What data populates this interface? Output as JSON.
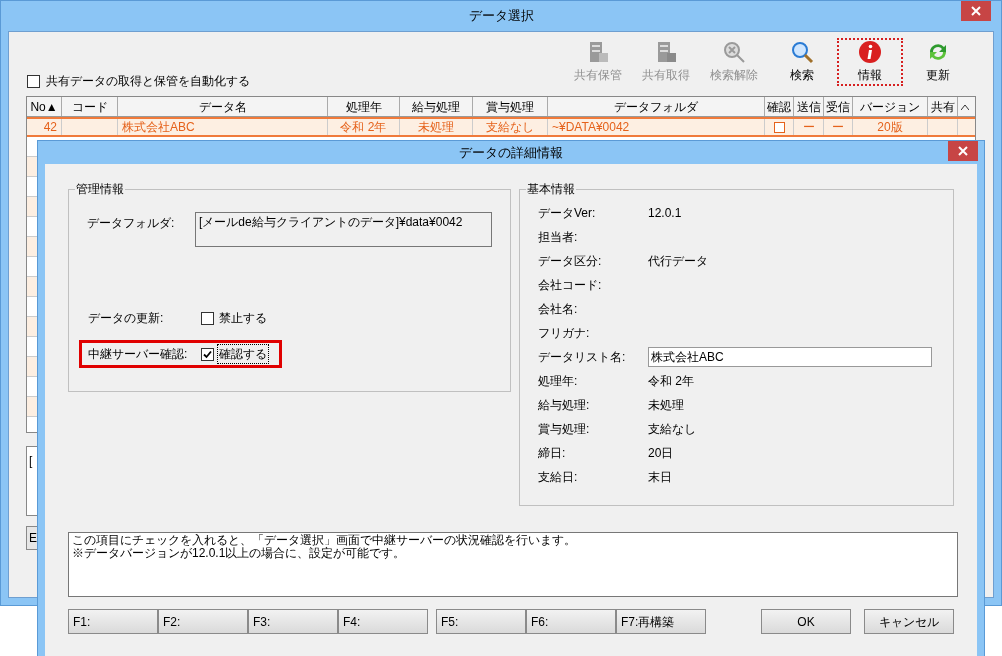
{
  "main_window": {
    "title": "データ選択",
    "toolbar": [
      {
        "kind": "store",
        "label": "共有保管",
        "disabled": true,
        "selected": false
      },
      {
        "kind": "fetch",
        "label": "共有取得",
        "disabled": true,
        "selected": false
      },
      {
        "kind": "clear-search",
        "label": "検索解除",
        "disabled": true,
        "selected": false
      },
      {
        "kind": "search",
        "label": "検索",
        "disabled": false,
        "selected": false
      },
      {
        "kind": "info",
        "label": "情報",
        "disabled": false,
        "selected": true
      },
      {
        "kind": "refresh",
        "label": "更新",
        "disabled": false,
        "selected": false
      }
    ],
    "auto_share": {
      "label": "共有データの取得と保管を自動化する",
      "checked": false
    },
    "table": {
      "columns": [
        "No▲",
        "コード",
        "データ名",
        "処理年",
        "給与処理",
        "賞与処理",
        "データフォルダ",
        "確認",
        "送信",
        "受信",
        "バージョン",
        "共有"
      ],
      "rows": [
        {
          "selected": true,
          "cells": [
            {
              "kind": "text",
              "text": "42"
            },
            {
              "kind": "empty"
            },
            {
              "kind": "text",
              "text": "株式会社ABC"
            },
            {
              "kind": "text",
              "text": "令和 2年"
            },
            {
              "kind": "text",
              "text": "未処理"
            },
            {
              "kind": "text",
              "text": "支給なし"
            },
            {
              "kind": "text",
              "text": "~¥DATA¥0042"
            },
            {
              "kind": "check",
              "checked": false
            },
            {
              "kind": "text",
              "text": "ー"
            },
            {
              "kind": "text",
              "text": "ー"
            },
            {
              "kind": "text",
              "text": "20版"
            },
            {
              "kind": "empty"
            }
          ]
        }
      ]
    },
    "note_fragment": "[",
    "bottom_button": "E"
  },
  "dialog": {
    "title": "データの詳細情報",
    "management": {
      "title": "管理情報",
      "folder_label": "データフォルダ:",
      "folder_value": "[メールde給与クライアントのデータ]¥data¥0042",
      "options": [
        {
          "label": "データの更新:",
          "text": "禁止する",
          "checked": false,
          "highlighted": false,
          "focused": false
        },
        {
          "label": "中継サーバー確認:",
          "text": "確認する",
          "checked": true,
          "highlighted": true,
          "focused": true
        }
      ]
    },
    "basic": {
      "title": "基本情報",
      "fields": [
        {
          "kind": "text",
          "label": "データVer:",
          "value": "12.0.1"
        },
        {
          "kind": "text",
          "label": "担当者:"
        },
        {
          "kind": "text",
          "label": "データ区分:",
          "value": "代行データ"
        },
        {
          "kind": "text",
          "label": "会社コード:"
        },
        {
          "kind": "text",
          "label": "会社名:"
        },
        {
          "kind": "text",
          "label": "フリガナ:"
        },
        {
          "kind": "input",
          "label": "データリスト名:",
          "value": "株式会社ABC"
        },
        {
          "kind": "text",
          "label": "処理年:",
          "value": "令和 2年"
        },
        {
          "kind": "text",
          "label": "給与処理:",
          "value": "未処理"
        },
        {
          "kind": "text",
          "label": "賞与処理:",
          "value": "支給なし"
        },
        {
          "kind": "text",
          "label": "締日:",
          "value": "20日"
        },
        {
          "kind": "text",
          "label": "支給日:",
          "value": "末日"
        }
      ]
    },
    "help_text": [
      "この項目にチェックを入れると、「データ選択」画面で中継サーバーの状況確認を行います。",
      "※データバージョンが12.0.1以上の場合に、設定が可能です。"
    ],
    "function_keys": [
      [
        "F1:",
        "F2:",
        "F3:",
        "F4:"
      ],
      [
        "F5:",
        "F6:",
        "F7:再構築"
      ]
    ],
    "buttons": [
      "OK",
      "キャンセル"
    ]
  }
}
